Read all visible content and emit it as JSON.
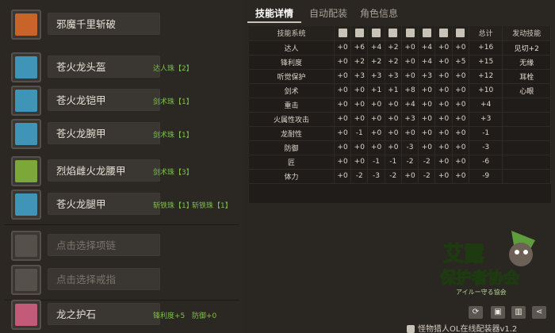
{
  "equipment": [
    {
      "name": "邪魔千里斩破",
      "decos": [],
      "icon": "weapon-icon",
      "color": "#c8642a"
    },
    {
      "name": "苍火龙头盔",
      "decos": [
        "达人珠【2】"
      ],
      "icon": "helmet-icon",
      "color": "#3f95b8"
    },
    {
      "name": "苍火龙铠甲",
      "decos": [
        "剑术珠【1】"
      ],
      "icon": "chest-armor-icon",
      "color": "#3f95b8"
    },
    {
      "name": "苍火龙腕甲",
      "decos": [
        "剑术珠【1】"
      ],
      "icon": "arm-armor-icon",
      "color": "#3f95b8"
    },
    {
      "name": "烈焰雌火龙腰甲",
      "decos": [
        "剑术珠【3】"
      ],
      "icon": "waist-armor-icon",
      "color": "#7ca83a"
    },
    {
      "name": "苍火龙腿甲",
      "decos": [
        "斩铁珠【1】",
        "斩铁珠【1】"
      ],
      "icon": "leg-armor-icon",
      "color": "#3f95b8"
    },
    {
      "name": "点击选择项链",
      "decos": [],
      "icon": "necklace-icon",
      "color": "#555049",
      "placeholder": true
    },
    {
      "name": "点击选择戒指",
      "decos": [],
      "icon": "ring-icon",
      "color": "#555049",
      "placeholder": true
    },
    {
      "name": "龙之护石",
      "decos": [
        "锋利度+5",
        "防御+0"
      ],
      "icon": "charm-icon",
      "color": "#c45a7a"
    }
  ],
  "tabs": [
    {
      "label": "技能详情"
    },
    {
      "label": "自动配装"
    },
    {
      "label": "角色信息"
    }
  ],
  "table": {
    "headers": {
      "skill": "技能系统",
      "total": "总计",
      "active": "发动技能"
    },
    "header_icons": [
      "weapon-icon",
      "helmet-icon",
      "chest-armor-icon",
      "arm-armor-icon",
      "waist-armor-icon",
      "leg-armor-icon",
      "necklace-icon",
      "ring-icon"
    ],
    "rows": [
      {
        "skill": "达人",
        "vals": [
          "+0",
          "+6",
          "+4",
          "+2",
          "+0",
          "+4",
          "+0",
          "+0"
        ],
        "total": "+16",
        "active": "见切+2"
      },
      {
        "skill": "锋利度",
        "vals": [
          "+0",
          "+2",
          "+2",
          "+2",
          "+0",
          "+4",
          "+0",
          "+5"
        ],
        "total": "+15",
        "active": "无缘"
      },
      {
        "skill": "听觉保护",
        "vals": [
          "+0",
          "+3",
          "+3",
          "+3",
          "+0",
          "+3",
          "+0",
          "+0"
        ],
        "total": "+12",
        "active": "耳栓"
      },
      {
        "skill": "剑术",
        "vals": [
          "+0",
          "+0",
          "+1",
          "+1",
          "+8",
          "+0",
          "+0",
          "+0"
        ],
        "total": "+10",
        "active": "心眼"
      },
      {
        "skill": "重击",
        "vals": [
          "+0",
          "+0",
          "+0",
          "+0",
          "+4",
          "+0",
          "+0",
          "+0"
        ],
        "total": "+4",
        "active": ""
      },
      {
        "skill": "火属性攻击",
        "vals": [
          "+0",
          "+0",
          "+0",
          "+0",
          "+3",
          "+0",
          "+0",
          "+0"
        ],
        "total": "+3",
        "active": ""
      },
      {
        "skill": "龙耐性",
        "vals": [
          "+0",
          "-1",
          "+0",
          "+0",
          "+0",
          "+0",
          "+0",
          "+0"
        ],
        "total": "-1",
        "active": ""
      },
      {
        "skill": "防御",
        "vals": [
          "+0",
          "+0",
          "+0",
          "+0",
          "-3",
          "+0",
          "+0",
          "+0"
        ],
        "total": "-3",
        "active": ""
      },
      {
        "skill": "匠",
        "vals": [
          "+0",
          "+0",
          "-1",
          "-1",
          "-2",
          "-2",
          "+0",
          "+0"
        ],
        "total": "-6",
        "active": ""
      },
      {
        "skill": "体力",
        "vals": [
          "+0",
          "-2",
          "-3",
          "-2",
          "+0",
          "-2",
          "+0",
          "+0"
        ],
        "total": "-9",
        "active": ""
      }
    ]
  },
  "logo": {
    "line1": "艾露",
    "line2": "保护者协会",
    "line3": "アイルー守る協会"
  },
  "bottom_buttons": [
    {
      "label": "load",
      "icon": "load-icon"
    },
    {
      "label": "save",
      "icon": "save-icon"
    },
    {
      "label": "delete",
      "icon": "trash-icon"
    },
    {
      "label": "share",
      "icon": "share-icon"
    }
  ],
  "footer": {
    "text": "怪物猎人OL在线配装器v1.2"
  }
}
